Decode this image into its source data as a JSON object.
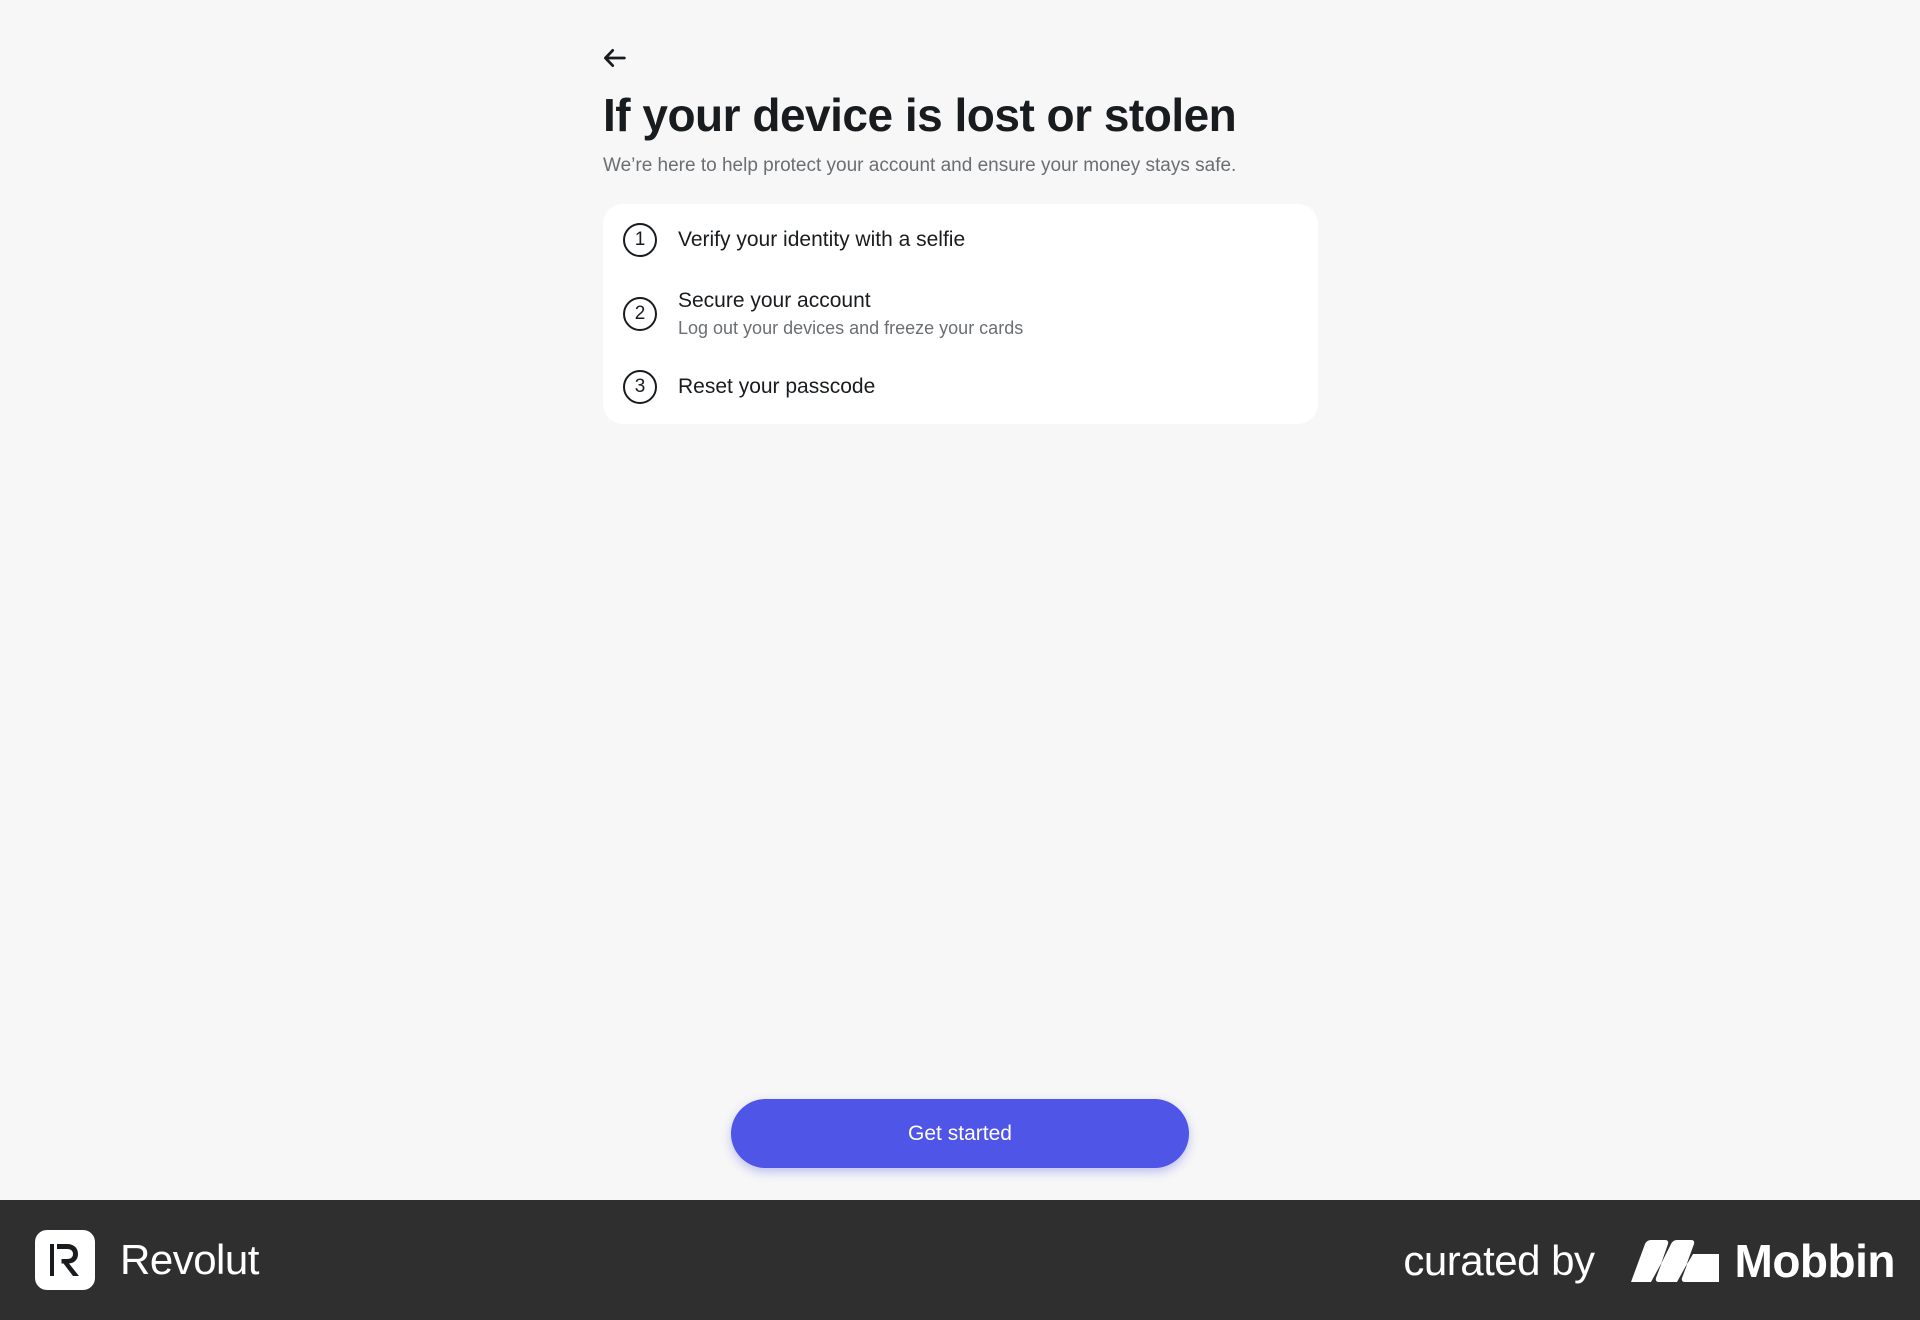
{
  "header": {
    "back_icon": "arrow-left-icon"
  },
  "main": {
    "title": "If your device is lost or stolen",
    "subtitle": "We’re here to help protect your account and ensure your money stays safe.",
    "steps": [
      {
        "number": "1",
        "title": "Verify your identity with a selfie",
        "description": ""
      },
      {
        "number": "2",
        "title": "Secure your account",
        "description": "Log out your devices and freeze your cards"
      },
      {
        "number": "3",
        "title": "Reset your passcode",
        "description": ""
      }
    ],
    "cta_label": "Get started",
    "accent_color": "#4f55e6"
  },
  "footer": {
    "brand_name": "Revolut",
    "brand_icon": "revolut-logo-icon",
    "curated_label": "curated by",
    "curator_name": "Mobbin",
    "curator_icon": "mobbin-logo-icon"
  }
}
